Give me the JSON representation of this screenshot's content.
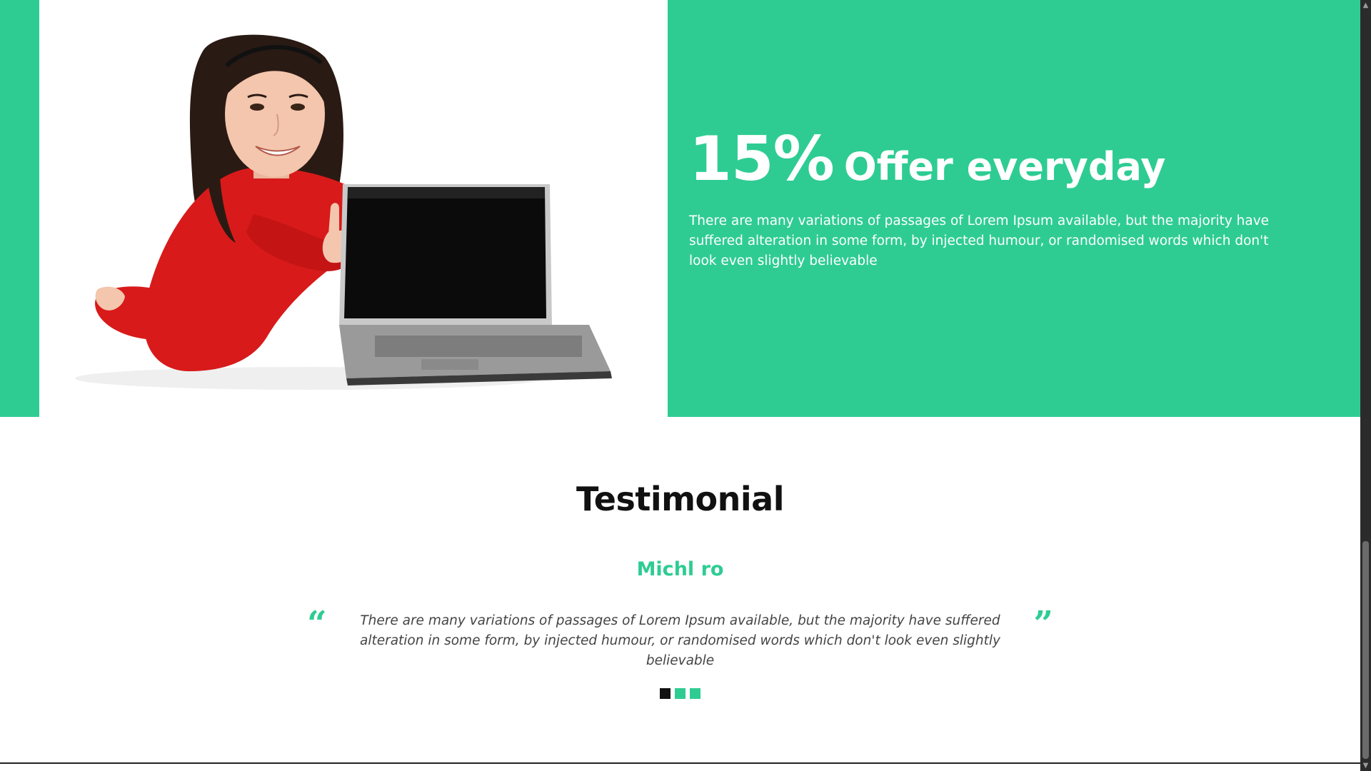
{
  "offer": {
    "percent": "15%",
    "title": "Offer everyday",
    "description": "There are many variations of passages of Lorem Ipsum available, but the majority have suffered alteration in some form, by injected humour, or randomised words which don't look even slightly believable"
  },
  "testimonial": {
    "title": "Testimonial",
    "client_name": "Michl ro",
    "quote": "There are many variations of passages of Lorem Ipsum available, but the majority have suffered alteration in some form, by injected humour, or randomised words which don't look even slightly believable",
    "open_quote_glyph": "“",
    "close_quote_glyph": "”",
    "active_slide": 1,
    "slide_count": 3
  },
  "colors": {
    "accent": "#2ecc93",
    "heading": "#111111",
    "body_text": "#444444",
    "active_indicator": "#111111"
  },
  "icons": {
    "open_quote": "open-quote-icon",
    "close_quote": "close-quote-icon",
    "scroll_up": "scroll-up-arrow-icon",
    "scroll_down": "scroll-down-arrow-icon"
  }
}
